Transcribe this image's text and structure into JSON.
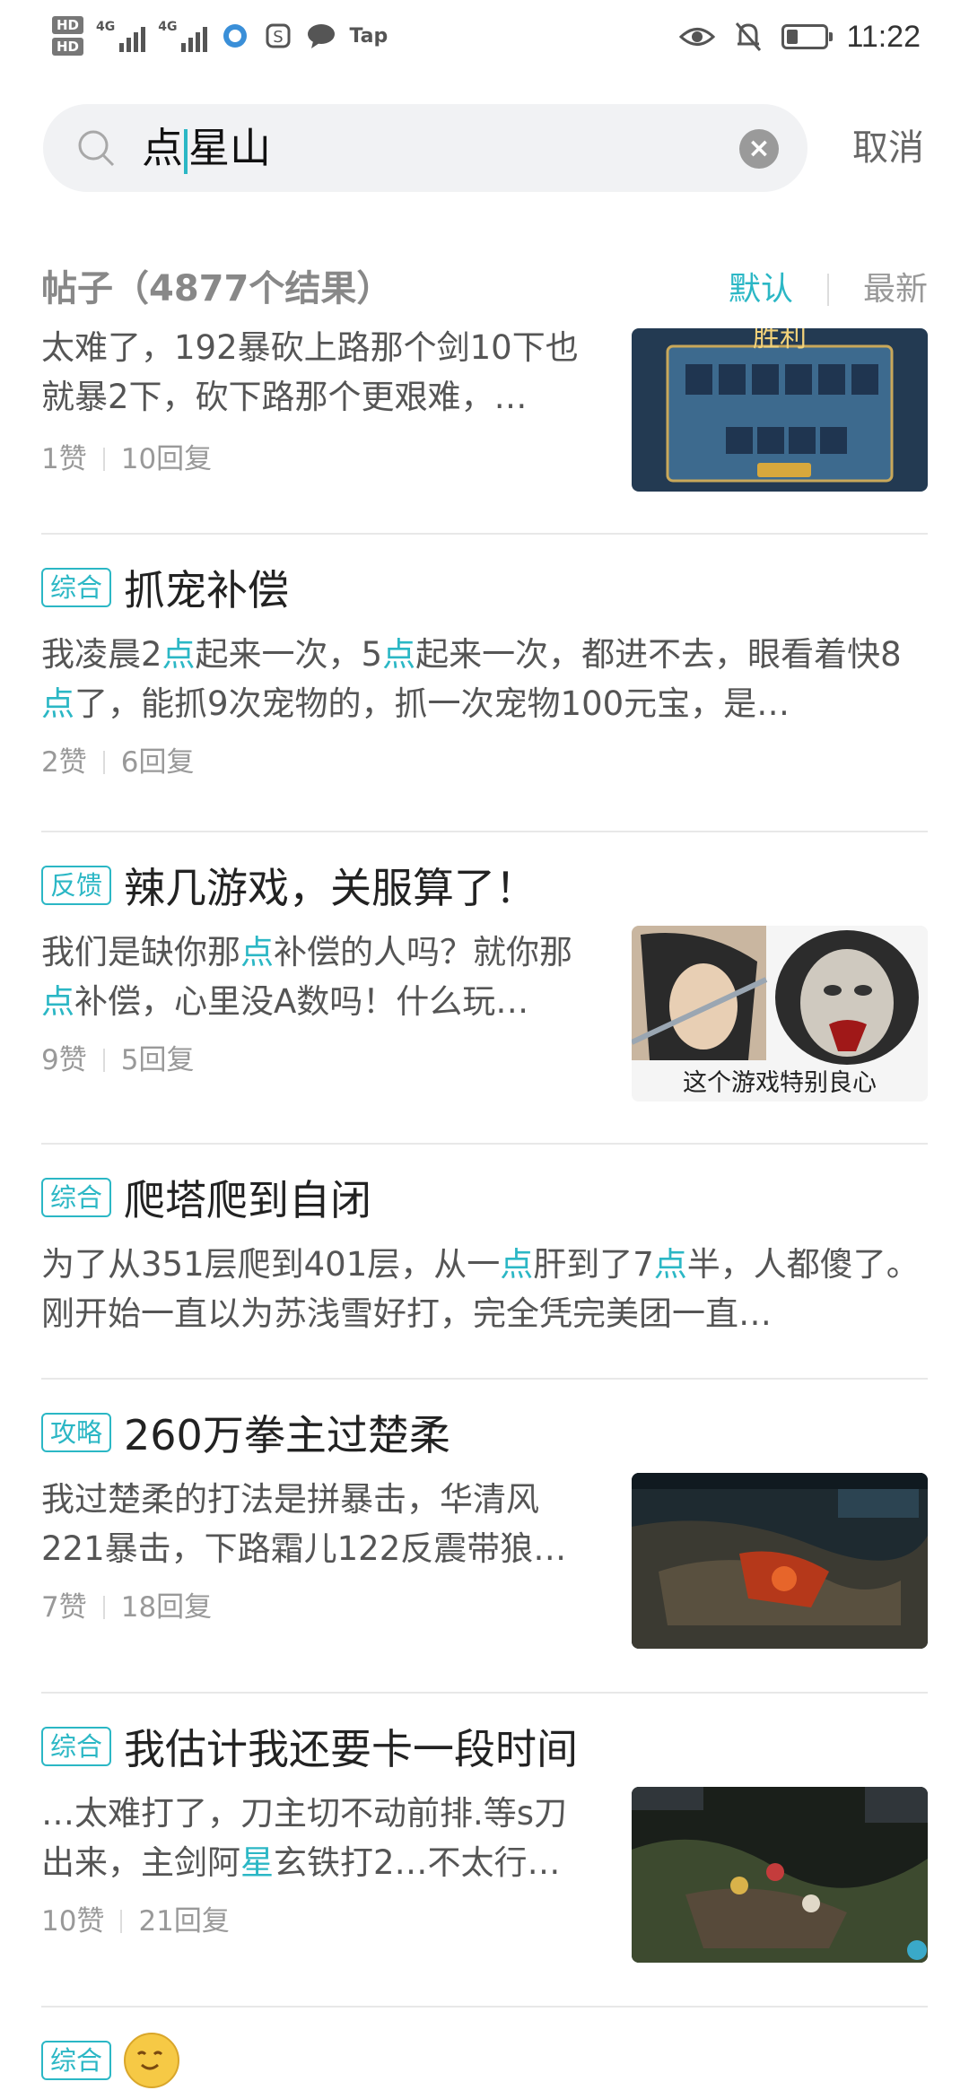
{
  "status_bar": {
    "hd1": "HD",
    "hd2": "HD",
    "sim1": "4G",
    "sim2": "4G",
    "app_label": "Tap",
    "time": "11:22",
    "battery_level": 0.3
  },
  "search": {
    "query_before_cursor": "点",
    "query_after_cursor": "星山",
    "cancel_label": "取消"
  },
  "results_header": {
    "title": "帖子（4877个结果）",
    "sort_default": "默认",
    "sort_latest": "最新"
  },
  "posts": [
    {
      "excerpt_parts": [
        "太难了，192暴砍上路那个剑10下也就暴2下，砍下路那个更艰难，…"
      ],
      "likes": "1赞",
      "replies": "10回复",
      "thumb": "victory-screen"
    },
    {
      "tag": "综合",
      "title": "抓宠补偿",
      "excerpt_parts": [
        "我凌晨2",
        "点",
        "起来一次，5",
        "点",
        "起来一次，都进不去，眼看着快8",
        "点",
        "了，能抓9次宠物的，抓一次宠物100元宝，是…"
      ],
      "likes": "2赞",
      "replies": "6回复"
    },
    {
      "tag": "反馈",
      "title": "辣几游戏，关服算了！",
      "excerpt_parts": [
        "我们是缺你那",
        "点",
        "补偿的人吗？就你那",
        "点",
        "补偿，心里没A数吗！什么玩…"
      ],
      "likes": "9赞",
      "replies": "5回复",
      "thumb_caption": "这个游戏特别良心"
    },
    {
      "tag": "综合",
      "title": "爬塔爬到自闭",
      "excerpt_parts": [
        "为了从351层爬到401层，从一",
        "点",
        "肝到了7",
        "点",
        "半，人都傻了。刚开始一直以为苏浅雪好打，完全凭完美团一直…"
      ],
      "likes": "",
      "replies": ""
    },
    {
      "tag": "攻略",
      "title": "260万拳主过楚柔",
      "excerpt_parts": [
        "我过楚柔的打法是拼暴击，华清风221暴击，下路霜儿122反震带狼…"
      ],
      "likes": "7赞",
      "replies": "18回复",
      "thumb": "battle-scene"
    },
    {
      "tag": "综合",
      "title": "我估计我还要卡一段时间",
      "excerpt_parts": [
        "…太难打了，刀主切不动前排.等s刀出来，主剑阿",
        "星",
        "玄铁打2…不太行…"
      ],
      "likes": "10赞",
      "replies": "21回复",
      "thumb": "battle-scene-2"
    },
    {
      "tag": "综合",
      "title": ""
    }
  ],
  "colors": {
    "accent": "#2bb7c5",
    "text_primary": "#222222",
    "text_secondary": "#555555",
    "text_muted": "#999999"
  }
}
